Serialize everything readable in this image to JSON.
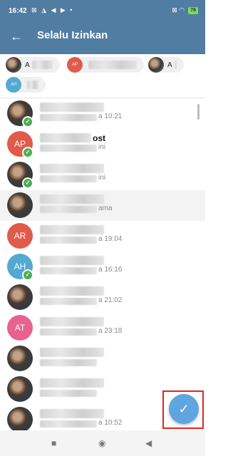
{
  "status": {
    "time": "16:42",
    "icons": "⊠ ◮ ◀ ▶ •",
    "right_icons": "⊠ ◠",
    "battery": "76"
  },
  "appbar": {
    "back_icon": "arrow-left-icon",
    "title": "Selalu Izinkan"
  },
  "chips": [
    {
      "avatar_text": "",
      "avatar_color": "#5b6b73",
      "label": "A",
      "photo": true
    },
    {
      "avatar_text": "AP",
      "avatar_color": "#e05b4a",
      "label": "",
      "photo": false
    },
    {
      "avatar_text": "",
      "avatar_color": "#5b6b73",
      "label": "A",
      "photo": true
    },
    {
      "avatar_text": "AH",
      "avatar_color": "#54a9d3",
      "label": "",
      "photo": false
    }
  ],
  "rows": [
    {
      "avatar_text": "",
      "avatar_color": "",
      "photo": true,
      "checked": true,
      "selected": false,
      "name": "",
      "sub": "a 10:21"
    },
    {
      "avatar_text": "AP",
      "avatar_color": "#e05b4a",
      "photo": false,
      "checked": true,
      "selected": false,
      "name": "ost",
      "sub": "ini"
    },
    {
      "avatar_text": "",
      "avatar_color": "",
      "photo": true,
      "checked": true,
      "selected": false,
      "name": "",
      "sub": "ini"
    },
    {
      "avatar_text": "",
      "avatar_color": "",
      "photo": true,
      "checked": false,
      "selected": true,
      "name": "",
      "sub": "ama"
    },
    {
      "avatar_text": "AR",
      "avatar_color": "#e05b4a",
      "photo": false,
      "checked": false,
      "selected": false,
      "name": "",
      "sub": "a 19:04"
    },
    {
      "avatar_text": "AH",
      "avatar_color": "#54a9d3",
      "photo": false,
      "checked": true,
      "selected": false,
      "name": "",
      "sub": "a 16:16"
    },
    {
      "avatar_text": "",
      "avatar_color": "",
      "photo": true,
      "checked": false,
      "selected": false,
      "name": "",
      "sub": "a 21:02"
    },
    {
      "avatar_text": "AT",
      "avatar_color": "#e8628f",
      "photo": false,
      "checked": false,
      "selected": false,
      "name": "",
      "sub": "a 23:18"
    },
    {
      "avatar_text": "",
      "avatar_color": "",
      "photo": true,
      "checked": false,
      "selected": false,
      "name": "",
      "sub": ""
    },
    {
      "avatar_text": "",
      "avatar_color": "",
      "photo": true,
      "checked": false,
      "selected": false,
      "name": "",
      "sub": ""
    },
    {
      "avatar_text": "",
      "avatar_color": "",
      "photo": true,
      "checked": false,
      "selected": false,
      "name": "",
      "sub": "a 10:52"
    }
  ],
  "fab": {
    "icon": "checkmark-icon",
    "glyph": "✓"
  },
  "nav": {
    "recent": "■",
    "home": "◉",
    "back": "◀"
  },
  "colors": {
    "header": "#517da2",
    "fab": "#5fa5e0",
    "check": "#4caf50",
    "highlight": "#e0261f"
  }
}
